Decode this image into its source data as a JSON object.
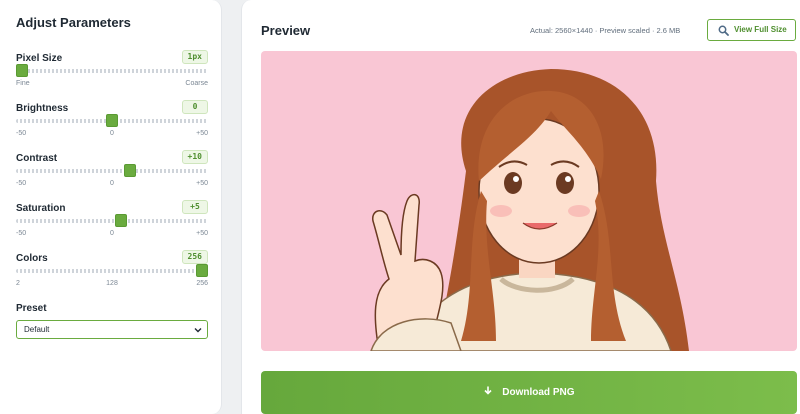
{
  "sidebar": {
    "title": "Adjust Parameters",
    "params": [
      {
        "label": "Pixel Size",
        "value": "1px",
        "fraction": 0.0,
        "ticks": [
          "Fine",
          "",
          "Coarse"
        ]
      },
      {
        "label": "Brightness",
        "value": "0",
        "fraction": 0.5,
        "ticks": [
          "-50",
          "0",
          "+50"
        ]
      },
      {
        "label": "Contrast",
        "value": "+10",
        "fraction": 0.6,
        "ticks": [
          "-50",
          "0",
          "+50"
        ]
      },
      {
        "label": "Saturation",
        "value": "+5",
        "fraction": 0.55,
        "ticks": [
          "-50",
          "0",
          "+50"
        ]
      },
      {
        "label": "Colors",
        "value": "256",
        "fraction": 1.0,
        "ticks": [
          "2",
          "128",
          "256"
        ]
      }
    ],
    "preset_label": "Preset",
    "preset_value": "Default"
  },
  "main": {
    "title": "Preview",
    "meta": "Actual: 2560×1440 · Preview scaled · 2.6 MB",
    "full_size_label": "View Full Size",
    "download_label": "Download PNG"
  },
  "colors": {
    "accent": "#6aab3f",
    "preview_bg": "#f9c6d4"
  },
  "icons": {
    "full_size": "magnifier-icon",
    "download": "download-icon",
    "preset": "chevron-down-icon"
  }
}
